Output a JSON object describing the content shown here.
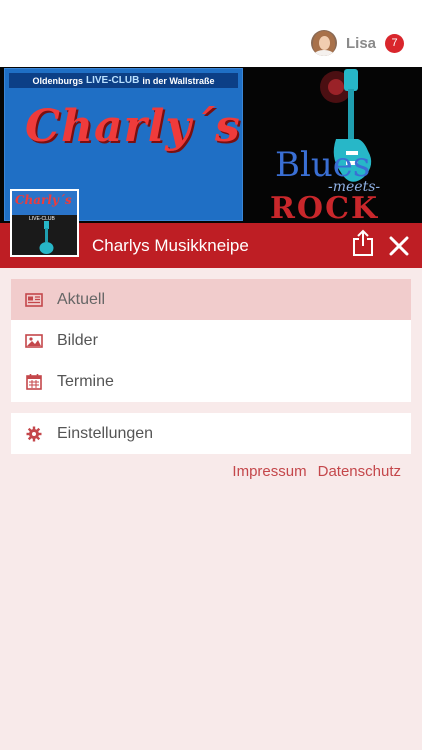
{
  "user": {
    "name": "Lisa",
    "notifications": "7"
  },
  "banner": {
    "strip": {
      "prefix": "Oldenburgs",
      "live": "LIVE-CLUB",
      "suffix": "in der Wallstraße"
    },
    "logo": "Charly´s",
    "blues": "Blues",
    "meets": "-meets-",
    "rock": "ROCK"
  },
  "thumbnail": {
    "logo": "Charly´s",
    "live": "LIVE-CLUB"
  },
  "header": {
    "title": "Charlys Musikkneipe"
  },
  "menu": {
    "items": [
      {
        "label": "Aktuell",
        "icon": "newspaper-icon",
        "active": true
      },
      {
        "label": "Bilder",
        "icon": "image-icon",
        "active": false
      },
      {
        "label": "Termine",
        "icon": "calendar-icon",
        "active": false
      }
    ],
    "settings": {
      "label": "Einstellungen",
      "icon": "gear-icon"
    }
  },
  "footer": {
    "impressum": "Impressum",
    "datenschutz": "Datenschutz"
  },
  "colors": {
    "accent": "#be1e24",
    "background": "#f8eaea",
    "active_item": "#f1cccc",
    "link": "#c4474b"
  }
}
